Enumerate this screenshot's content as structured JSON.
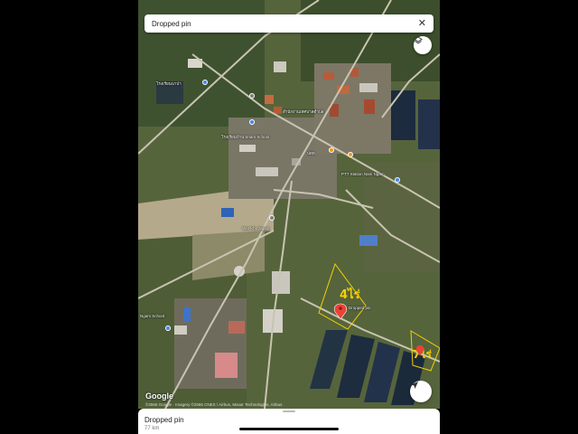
{
  "search": {
    "title": "Dropped pin"
  },
  "map": {
    "labels": [
      "โรงเรียนนาป่า",
      "สำนักงานเทศบาลตำบล",
      "โรงเรียนบ้าน\nSnam School",
      "ปตท.",
      "PTT Station Nam Ngam",
      "Wat Kho Ngam",
      "Ngam School",
      "Dropped pin"
    ],
    "google_logo": "Google",
    "attribution": "©2566 Google · Imagery ©2566 CNES / Airbus, Maxar Technologies, Airbus"
  },
  "sheet": {
    "title": "Dropped pin",
    "distance": "77 km"
  },
  "colors": {
    "pin": "#ea4335",
    "boundary": "#f5d000"
  }
}
